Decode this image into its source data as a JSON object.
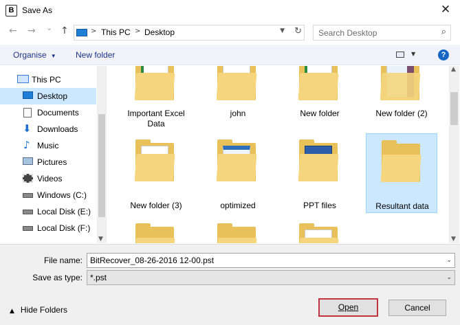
{
  "window": {
    "title": "Save As",
    "app_icon_letter": "B",
    "close_symbol": "✕"
  },
  "nav": {
    "back_symbol": "←",
    "forward_symbol": "→",
    "recent_symbol": "⌄",
    "up_symbol": "↑",
    "breadcrumbs": [
      "This PC",
      "Desktop"
    ],
    "crumb_separator": ">",
    "search_placeholder": "Search Desktop"
  },
  "toolbar": {
    "organise_label": "Organise",
    "new_folder_label": "New folder",
    "help_symbol": "?"
  },
  "sidebar": {
    "items": [
      {
        "label": "This PC",
        "icon": "computer-icon"
      },
      {
        "label": "Desktop",
        "icon": "desktop-icon",
        "selected": true
      },
      {
        "label": "Documents",
        "icon": "documents-icon"
      },
      {
        "label": "Downloads",
        "icon": "downloads-icon"
      },
      {
        "label": "Music",
        "icon": "music-icon"
      },
      {
        "label": "Pictures",
        "icon": "pictures-icon"
      },
      {
        "label": "Videos",
        "icon": "videos-icon"
      },
      {
        "label": "Windows (C:)",
        "icon": "drive-icon"
      },
      {
        "label": "Local Disk (E:)",
        "icon": "drive-icon"
      },
      {
        "label": "Local Disk (F:)",
        "icon": "drive-icon"
      }
    ]
  },
  "files": [
    {
      "name_line1": "Important Excel",
      "name_line2": "Data"
    },
    {
      "name_line1": "john",
      "name_line2": ""
    },
    {
      "name_line1": "New folder",
      "name_line2": ""
    },
    {
      "name_line1": "New folder (2)",
      "name_line2": ""
    },
    {
      "name_line1": "New folder (3)",
      "name_line2": ""
    },
    {
      "name_line1": "optimized",
      "name_line2": ""
    },
    {
      "name_line1": "PPT files",
      "name_line2": ""
    },
    {
      "name_line1": "Resultant data",
      "name_line2": "",
      "selected": true
    }
  ],
  "form": {
    "filename_label": "File name:",
    "filename_value": "BitRecover_08-26-2016 12-00.pst",
    "savetype_label": "Save as type:",
    "savetype_value": "*.pst"
  },
  "footer": {
    "hide_folders_label": "Hide Folders",
    "open_label": "Open",
    "cancel_label": "Cancel"
  },
  "colors": {
    "selection": "#cce8ff",
    "accent_blue": "#1766c4",
    "highlight_border": "#c4323c",
    "folder": "#e8c15a"
  }
}
